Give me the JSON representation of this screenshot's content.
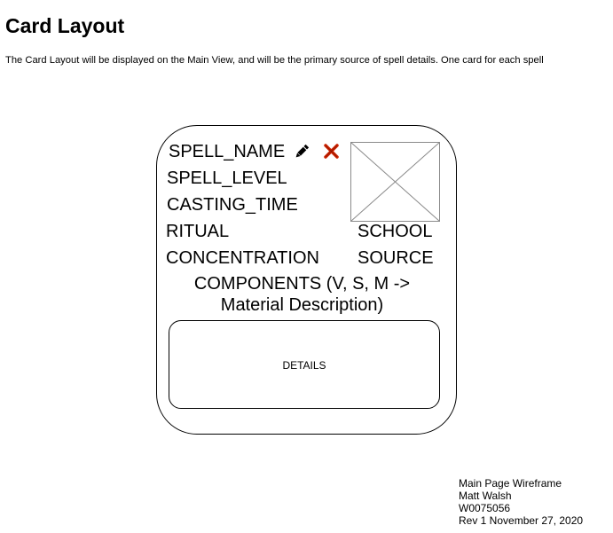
{
  "header": {
    "title": "Card Layout",
    "description": "The Card Layout will be displayed on the Main View, and will be the primary source of spell details. One card for each spell"
  },
  "card": {
    "spell_name": "SPELL_NAME",
    "spell_level": "SPELL_LEVEL",
    "casting_time": "CASTING_TIME",
    "ritual": "RITUAL",
    "concentration": "CONCENTRATION",
    "school": "SCHOOL",
    "source": "SOURCE",
    "components_line1": "COMPONENTS (V, S, M ->",
    "components_line2": "Material Description)",
    "details": "DETAILS",
    "edit_icon": "pencil-icon",
    "delete_icon": "close-icon",
    "image_icon": "image-placeholder-icon",
    "delete_color": "#cc2200"
  },
  "footer": {
    "line1": "Main Page Wireframe",
    "line2": "Matt Walsh",
    "line3": "W0075056",
    "line4": "Rev 1 November 27, 2020"
  }
}
